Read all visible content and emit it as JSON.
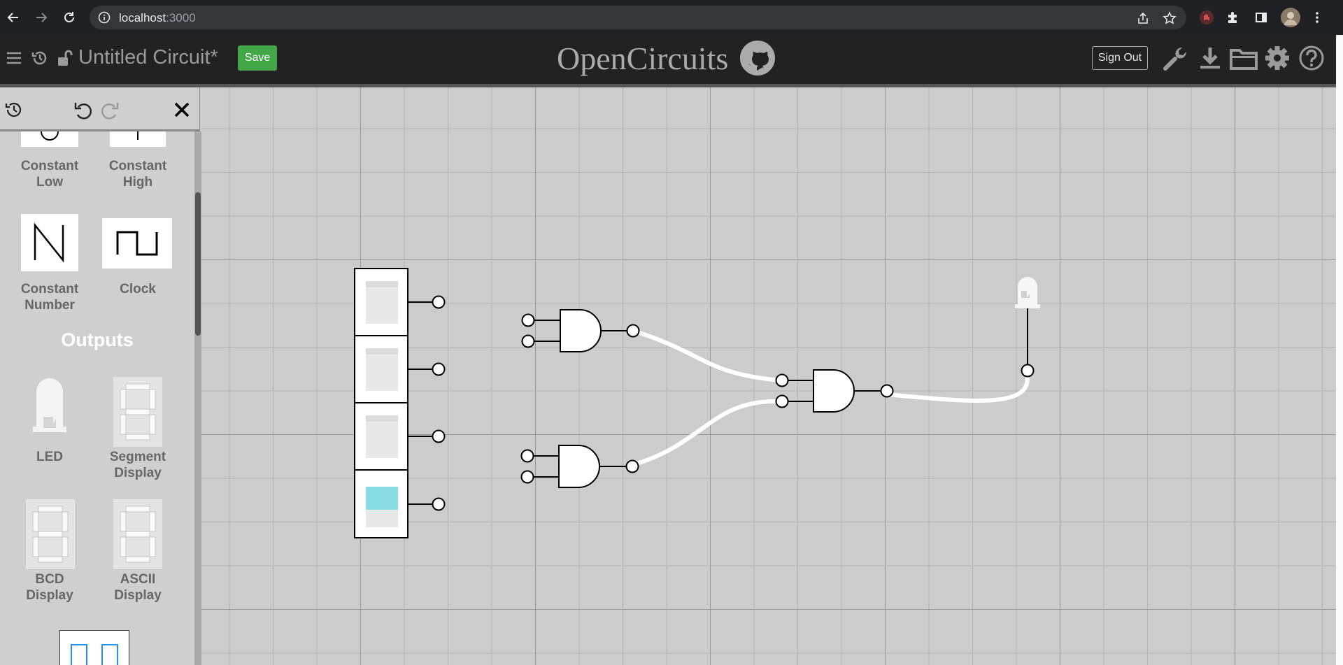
{
  "browser": {
    "url_host": "localhost",
    "url_port": ":3000"
  },
  "header": {
    "circuit_name": "Untitled Circuit*",
    "save_label": "Save",
    "logo_text": "OpenCircuits",
    "signout_label": "Sign Out"
  },
  "sidebar": {
    "items_top": [
      {
        "label": "Constant\nLow"
      },
      {
        "label": "Constant\nHigh"
      },
      {
        "label": "Constant\nNumber"
      },
      {
        "label": "Clock"
      }
    ],
    "outputs_title": "Outputs",
    "outputs": [
      {
        "label": "LED"
      },
      {
        "label": "Segment\nDisplay"
      },
      {
        "label": "BCD\nDisplay"
      },
      {
        "label": "ASCII\nDisplay"
      }
    ]
  },
  "circuit": {
    "switches": [
      false,
      false,
      false,
      true
    ],
    "led_on": false,
    "colors": {
      "wire_on": "#ffffff",
      "switch_on": "#88dde3",
      "switch_off": "#e8e8e8",
      "save_green": "#43a748"
    }
  }
}
